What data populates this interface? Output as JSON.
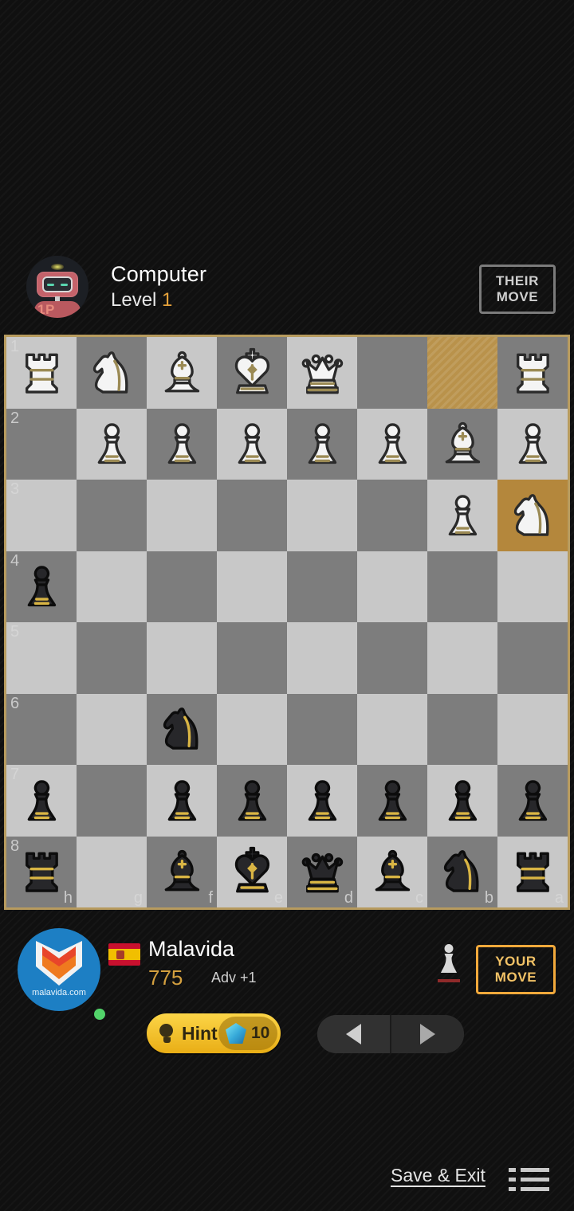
{
  "opponent": {
    "avatar_icon": "robot-avatar-icon",
    "player_badge": "1P",
    "name": "Computer",
    "level_label": "Level",
    "level_value": "1",
    "turn_badge_line1": "THEIR",
    "turn_badge_line2": "MOVE"
  },
  "player": {
    "avatar_icon": "malavida-logo-icon",
    "avatar_text": "malavida.com",
    "flag_icon": "spain-flag-icon",
    "name": "Malavida",
    "rating": "775",
    "advantage": "Adv +1",
    "online": true,
    "captured_icon": "captured-white-pawn-icon",
    "turn_badge_line1": "YOUR",
    "turn_badge_line2": "MOVE"
  },
  "controls": {
    "hint_label": "Hint",
    "hint_icon": "lightbulb-icon",
    "gem_icon": "gem-icon",
    "gem_count": "10",
    "prev_icon": "triangle-left-icon",
    "next_icon": "triangle-right-icon"
  },
  "footer": {
    "save_exit_label": "Save & Exit",
    "menu_icon": "list-menu-icon"
  },
  "board": {
    "orientation": "black",
    "rank_labels": [
      "1",
      "2",
      "3",
      "4",
      "5",
      "6",
      "7",
      "8"
    ],
    "file_labels": [
      "h",
      "g",
      "f",
      "e",
      "d",
      "c",
      "b",
      "a"
    ],
    "colors": {
      "light_square": "#c8c8c8",
      "dark_square": "#7d7d7d",
      "highlight_from": "#b9924b",
      "highlight_to": "#b4873c",
      "border": "#b79b5e"
    },
    "highlight_from_square": "b1",
    "highlight_to_square": "a3",
    "rows": [
      [
        "wR",
        "wN",
        "wB",
        "wK",
        "wQ",
        "",
        "",
        "wR"
      ],
      [
        "",
        "wP",
        "wP",
        "wP",
        "wP",
        "wP",
        "wB",
        "wP"
      ],
      [
        "",
        "",
        "",
        "",
        "",
        "",
        "wP",
        "wN"
      ],
      [
        "bP",
        "",
        "",
        "",
        "",
        "",
        "",
        ""
      ],
      [
        "",
        "",
        "",
        "",
        "",
        "",
        "",
        ""
      ],
      [
        "",
        "",
        "bN",
        "",
        "",
        "",
        "",
        ""
      ],
      [
        "bP",
        "",
        "bP",
        "bP",
        "bP",
        "bP",
        "bP",
        "bP"
      ],
      [
        "bR",
        "",
        "bB",
        "bK",
        "bQ",
        "bB",
        "bN",
        "bR"
      ]
    ]
  }
}
